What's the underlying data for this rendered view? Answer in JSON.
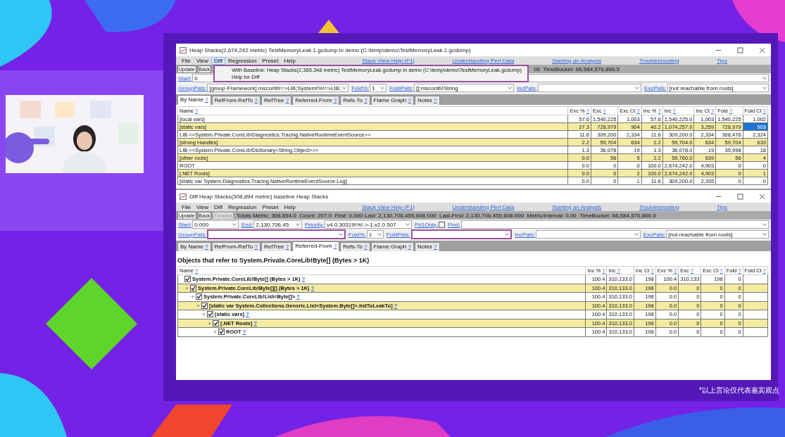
{
  "caption": "*以上言论仅代表嘉宾观点",
  "windows": [
    {
      "title": "Heap Stacks(2,674,242 metric) TestMemoryLeak.1.gcdump in demo (C:\\temp\\demo\\TestMemoryLeak.1.gcdump)",
      "menu": [
        {
          "label": "File",
          "selected": false
        },
        {
          "label": "View",
          "selected": false
        },
        {
          "label": "Diff",
          "selected": true
        },
        {
          "label": "Regression",
          "selected": false
        },
        {
          "label": "Preset",
          "selected": false
        },
        {
          "label": "Help",
          "selected": false
        }
      ],
      "help_links": [
        "Stack View Help (F1)",
        "Understanding Perf Data",
        "Starting an Analysis",
        "Troubleshooting",
        "Tips"
      ],
      "open_menu": {
        "items": [
          "With Baseline: Heap Stacks(2,365,348 metric) TestMemoryLeak.gcdump in demo (C:\\temp\\demo\\TestMemoryLeak.gcdump)",
          "Help for Diff"
        ]
      },
      "toolbar": [
        {
          "label": "Update",
          "disabled": false
        },
        {
          "label": "Back",
          "disabled": false
        }
      ],
      "status": "00  TimeBucket: 66,584,576,866.5",
      "filter_rows": [
        [
          {
            "kind": "short",
            "label": "Start:",
            "value": "0",
            "highlighted": false
          },
          {
            "kind": "wide",
            "highlighted": false
          }
        ],
        [
          {
            "kind": "long",
            "label": "GroupPats:",
            "value": "[group Framework] mscorlib!=>LIB;System!%!=>LIB;",
            "highlighted": false
          },
          {
            "kind": "tiny",
            "label": "Fold%:",
            "value": "1",
            "highlighted": false
          },
          {
            "kind": "wide",
            "label": "FoldPats:",
            "value": "[];mscorlib!String",
            "highlighted": false
          },
          {
            "kind": "wide",
            "label": "IncPats:",
            "highlighted": false
          },
          {
            "kind": "wide",
            "label": "ExcPats:",
            "value": "[not reachable from roots]",
            "highlighted": false
          }
        ]
      ],
      "tabs": [
        {
          "label": "By Name",
          "help": "?",
          "selected": true
        },
        {
          "label": "RefFrom-RefTo",
          "help": "?",
          "selected": false
        },
        {
          "label": "RefTree",
          "help": "?",
          "selected": false
        },
        {
          "label": "Referred-From",
          "help": "?",
          "selected": false
        },
        {
          "label": "Refs-To",
          "help": "?",
          "selected": false
        },
        {
          "label": "Flame Graph",
          "help": "?",
          "selected": false
        },
        {
          "label": "Notes",
          "help": "?",
          "selected": false
        }
      ],
      "table": {
        "kind": "list",
        "columns": [
          {
            "label": "Name",
            "help": "?"
          },
          {
            "label": "Exc %",
            "help": "?"
          },
          {
            "label": "Exc",
            "help": "?"
          },
          {
            "label": "Exc Ct",
            "help": "?"
          },
          {
            "label": "Inc %",
            "help": "?"
          },
          {
            "label": "Inc",
            "help": "?"
          },
          {
            "label": "Inc Ct",
            "help": "?"
          },
          {
            "label": "Fold",
            "help": "?"
          },
          {
            "label": "Fold Ct",
            "help": "?"
          }
        ],
        "rows": [
          {
            "cells": [
              "[local vars]",
              "57.6",
              "1,540,225",
              "1,003",
              "57.6",
              "1,540,225.0",
              "1,003",
              "1,540,225",
              "1,002"
            ],
            "selected": false
          },
          {
            "cells": [
              "[static vars]",
              "27.3",
              "728,979",
              "904",
              "40.2",
              "1,074,257.0",
              "3,259",
              "728,979",
              "903"
            ],
            "selected": true
          },
          {
            "cells": [
              "LIB <<System.Private.CoreLib!Diagnostics.Tracing.NativeRuntimeEventSource>>",
              "11.6",
              "309,200",
              "2,334",
              "11.6",
              "309,200.0",
              "2,334",
              "308,476",
              "2,324"
            ],
            "selected": false
          },
          {
            "cells": [
              "[strong Handles]",
              "2.2",
              "59,704",
              "634",
              "2.2",
              "59,704.0",
              "634",
              "59,704",
              "633"
            ],
            "selected": false
          },
          {
            "cells": [
              "LIB <<System.Private.CoreLib!Dictionary<String.Object>>>",
              "1.3",
              "36,078",
              "19",
              "1.3",
              "36,078.0",
              "19",
              "35,998",
              "18"
            ],
            "selected": false
          },
          {
            "cells": [
              "[other roots]",
              "0.0",
              "56",
              "5",
              "2.2",
              "59,760.0",
              "639",
              "56",
              "4"
            ],
            "selected": false
          },
          {
            "cells": [
              "ROOT",
              "0.0",
              "0",
              "0",
              "100.0",
              "2,674,242.0",
              "4,903",
              "0",
              "0"
            ],
            "selected": false
          },
          {
            "cells": [
              "[.NET Roots]",
              "0.0",
              "0",
              "2",
              "100.0",
              "2,674,242.0",
              "4,903",
              "0",
              "1"
            ],
            "selected": false
          },
          {
            "cells": [
              "[static var System.Diagnostics.Tracing.NativeRuntimeEventSource.Log]",
              "0.0",
              "0",
              "1",
              "11.6",
              "309,200.0",
              "2,335",
              "0",
              "0"
            ],
            "selected": false
          }
        ]
      }
    },
    {
      "title": "Diff Heap Stacks(308,894 metric) baseline Heap Stacks",
      "menu": [
        {
          "label": "File",
          "selected": false
        },
        {
          "label": "View",
          "selected": false
        },
        {
          "label": "Diff",
          "selected": false
        },
        {
          "label": "Regression",
          "selected": false
        },
        {
          "label": "Preset",
          "selected": false
        },
        {
          "label": "Help",
          "selected": false
        }
      ],
      "help_links": [
        "Stack View Help (F1)",
        "Understanding Perf Data",
        "Starting an Analysis",
        "Troubleshooting",
        "Tips"
      ],
      "toolbar": [
        {
          "label": "Update",
          "disabled": false
        },
        {
          "label": "Back",
          "disabled": false
        },
        {
          "label": "Forward",
          "disabled": true
        }
      ],
      "status": "Totals Metric: 308,894.0  Count: 207.0  First: 0.000 Last: 2,130,706,455,608.000  Last-First: 2,130,706,455,608.000  Metric/Interval: 0.00  TimeBucket: 66,584,576,866.5",
      "filter_rows": [
        [
          {
            "kind": "short",
            "label": "Start:",
            "value": "0.000",
            "highlighted": false
          },
          {
            "kind": "short",
            "label": "End:",
            "value": "2,130,706,45",
            "highlighted": false
          },
          {
            "kind": "mid",
            "label": "Priority:",
            "value": "v4.0.30319\\%!->-1;v2.0.507",
            "highlighted": false
          },
          {
            "kind": "check",
            "label": "Pri1Only:",
            "checked": false,
            "highlighted": false
          },
          {
            "kind": "wide",
            "label": "Find:",
            "highlighted": false
          }
        ],
        [
          {
            "kind": "long",
            "label": "GroupPats:",
            "highlighted": true
          },
          {
            "kind": "tiny",
            "label": "Fold%:",
            "value": "1",
            "highlighted": false
          },
          {
            "kind": "wide",
            "label": "FoldPats:",
            "highlighted": true
          },
          {
            "kind": "wide",
            "label": "IncPats:",
            "highlighted": false
          },
          {
            "kind": "wide",
            "label": "ExcPats:",
            "value": "[not reachable from roots]",
            "highlighted": false
          }
        ]
      ],
      "tabs": [
        {
          "label": "By Name",
          "help": "?",
          "selected": false
        },
        {
          "label": "RefFrom-RefTo",
          "help": "?",
          "selected": false
        },
        {
          "label": "RefTree",
          "help": "?",
          "selected": false
        },
        {
          "label": "Referred-From",
          "help": "?",
          "selected": true
        },
        {
          "label": "Refs-To",
          "help": "?",
          "selected": false
        },
        {
          "label": "Flame Graph",
          "help": "?",
          "selected": false
        },
        {
          "label": "Notes",
          "help": "?",
          "selected": false
        }
      ],
      "heading": "Objects that refer to System.Private.CoreLib!Byte[] (Bytes > 1K)",
      "table": {
        "kind": "tree",
        "columns": [
          {
            "label": "Name",
            "help": "?"
          },
          {
            "label": "Inc %",
            "help": "?"
          },
          {
            "label": "Inc",
            "help": "?"
          },
          {
            "label": "Inc Ct",
            "help": "?"
          },
          {
            "label": "Exc %",
            "help": "?"
          },
          {
            "label": "Exc",
            "help": "?"
          },
          {
            "label": "Exc Ct",
            "help": "?"
          },
          {
            "label": "Fold",
            "help": "?"
          },
          {
            "label": "Fold Ct",
            "help": "?"
          }
        ],
        "nodes": [
          {
            "name": "System.Private.CoreLib!Byte[] (Bytes > 1K)",
            "help": "?",
            "checked": true,
            "expander": false,
            "cells": [
              "100.4",
              "310,133.0",
              "198",
              "100.4",
              "310,133",
              "198",
              "0"
            ],
            "children": [
              {
                "name": "System.Private.CoreLib!Byte[][] (Bytes > 1K)",
                "help": "?",
                "checked": true,
                "expander": true,
                "cells": [
                  "100.4",
                  "310,133.0",
                  "198",
                  "0.0",
                  "0",
                  "0",
                  "0"
                ],
                "children": [
                  {
                    "name": "System.Private.CoreLib!List<Byte[]>",
                    "help": "?",
                    "checked": true,
                    "expander": true,
                    "cells": [
                      "100.4",
                      "310,133.0",
                      "198",
                      "0.0",
                      "0",
                      "0",
                      "0"
                    ],
                    "children": [
                      {
                        "name": "[static var System.Collections.Generic.List<System.Byte[]>.listToLeakTo]",
                        "help": "?",
                        "checked": true,
                        "expander": true,
                        "cells": [
                          "100.4",
                          "310,133.0",
                          "198",
                          "0.0",
                          "0",
                          "0",
                          "0"
                        ],
                        "children": [
                          {
                            "name": "[static vars]",
                            "help": "?",
                            "checked": true,
                            "expander": true,
                            "cells": [
                              "100.4",
                              "310,133.0",
                              "198",
                              "0.0",
                              "0",
                              "0",
                              "0"
                            ],
                            "children": [
                              {
                                "name": "[.NET Roots]",
                                "help": "?",
                                "checked": true,
                                "expander": true,
                                "cells": [
                                  "100.4",
                                  "310,133.0",
                                  "198",
                                  "0.0",
                                  "0",
                                  "0",
                                  "0"
                                ],
                                "children": [
                                  {
                                    "name": "ROOT",
                                    "help": "?",
                                    "checked": true,
                                    "expander": true,
                                    "cells": [
                                      "100.4",
                                      "310,133.0",
                                      "198",
                                      "0.0",
                                      "0",
                                      "0",
                                      "0"
                                    ]
                                  }
                                ]
                              }
                            ]
                          }
                        ]
                      }
                    ]
                  }
                ]
              }
            ]
          }
        ]
      }
    }
  ]
}
